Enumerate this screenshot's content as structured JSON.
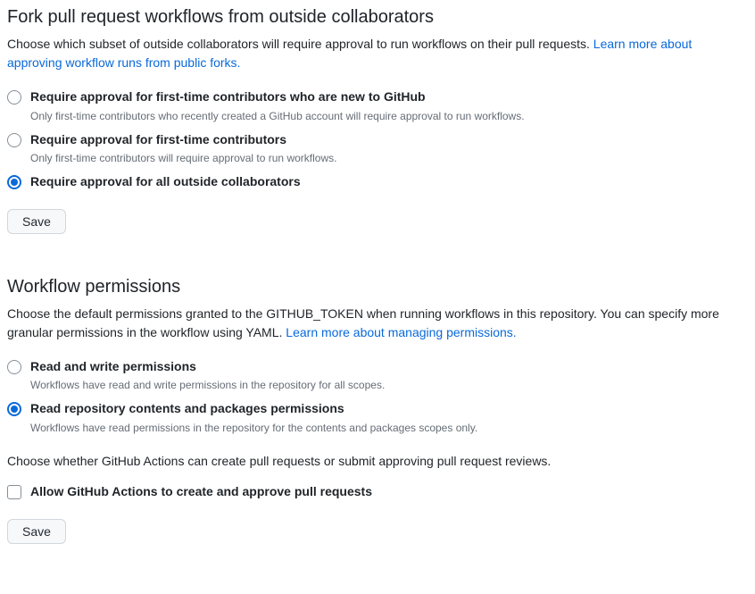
{
  "fork_section": {
    "title": "Fork pull request workflows from outside collaborators",
    "desc_prefix": "Choose which subset of outside collaborators will require approval to run workflows on their pull requests. ",
    "link_text": "Learn more about approving workflow runs from public forks.",
    "options": [
      {
        "label": "Require approval for first-time contributors who are new to GitHub",
        "help": "Only first-time contributors who recently created a GitHub account will require approval to run workflows.",
        "selected": false
      },
      {
        "label": "Require approval for first-time contributors",
        "help": "Only first-time contributors will require approval to run workflows.",
        "selected": false
      },
      {
        "label": "Require approval for all outside collaborators",
        "help": "",
        "selected": true
      }
    ],
    "save_label": "Save"
  },
  "workflow_section": {
    "title": "Workflow permissions",
    "desc_prefix": "Choose the default permissions granted to the GITHUB_TOKEN when running workflows in this repository. You can specify more granular permissions in the workflow using YAML. ",
    "link_text": "Learn more about managing permissions.",
    "options": [
      {
        "label": "Read and write permissions",
        "help": "Workflows have read and write permissions in the repository for all scopes.",
        "selected": false
      },
      {
        "label": "Read repository contents and packages permissions",
        "help": "Workflows have read permissions in the repository for the contents and packages scopes only.",
        "selected": true
      }
    ],
    "sub_desc": "Choose whether GitHub Actions can create pull requests or submit approving pull request reviews.",
    "checkbox_label": "Allow GitHub Actions to create and approve pull requests",
    "save_label": "Save"
  }
}
